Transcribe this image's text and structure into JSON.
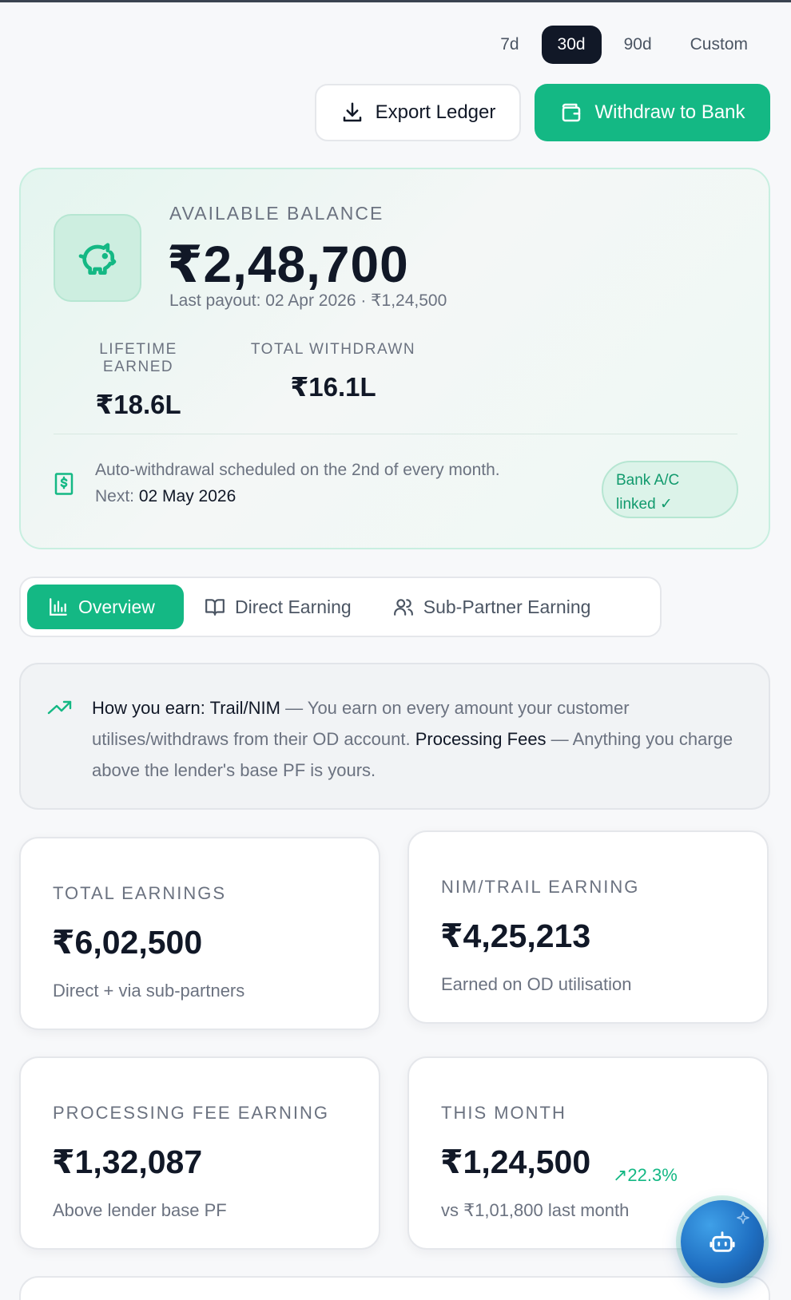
{
  "period_tabs": [
    {
      "label": "7d",
      "active": false
    },
    {
      "label": "30d",
      "active": true
    },
    {
      "label": "90d",
      "active": false
    },
    {
      "label": "Custom",
      "active": false
    }
  ],
  "actions": {
    "export_label": "Export Ledger",
    "withdraw_label": "Withdraw to Bank"
  },
  "balance": {
    "label": "AVAILABLE BALANCE",
    "amount": "₹2,48,700",
    "last_payout": "Last payout: 02 Apr 2026 · ₹1,24,500",
    "lifetime_label": "LIFETIME EARNED",
    "lifetime_value": "₹18.6L",
    "withdrawn_label": "TOTAL WITHDRAWN",
    "withdrawn_value": "₹16.1L",
    "auto_line": "Auto-withdrawal scheduled on the 2nd of every month.",
    "next_prefix": "Next:",
    "next_date": "02 May 2026",
    "bank_badge_line1": "Bank A/C",
    "bank_badge_line2": "linked ✓"
  },
  "tabs": [
    {
      "label": "Overview",
      "active": true
    },
    {
      "label": "Direct Earning",
      "active": false
    },
    {
      "label": "Sub-Partner Earning",
      "active": false
    }
  ],
  "info": {
    "title1": "How you earn: Trail/NIM",
    "text1": " — You earn on every amount your customer utilises/withdraws from their OD account. ",
    "title2": "Processing Fees",
    "text2": " — Anything you charge above the lender's base PF is yours."
  },
  "cards": [
    {
      "label": "TOTAL EARNINGS",
      "value": "₹6,02,500",
      "sub": "Direct + via sub-partners"
    },
    {
      "label": "NIM/TRAIL EARNING",
      "value": "₹4,25,213",
      "sub": "Earned on OD utilisation"
    },
    {
      "label": "PROCESSING FEE EARNING",
      "value": "₹1,32,087",
      "sub": "Above lender base PF"
    },
    {
      "label": "THIS MONTH",
      "value": "₹1,24,500",
      "sub": "vs ₹1,01,800 last month",
      "change": "↗22.3%"
    }
  ],
  "colors": {
    "accent": "#14b884",
    "dark": "#111827",
    "muted": "#6b7280"
  }
}
